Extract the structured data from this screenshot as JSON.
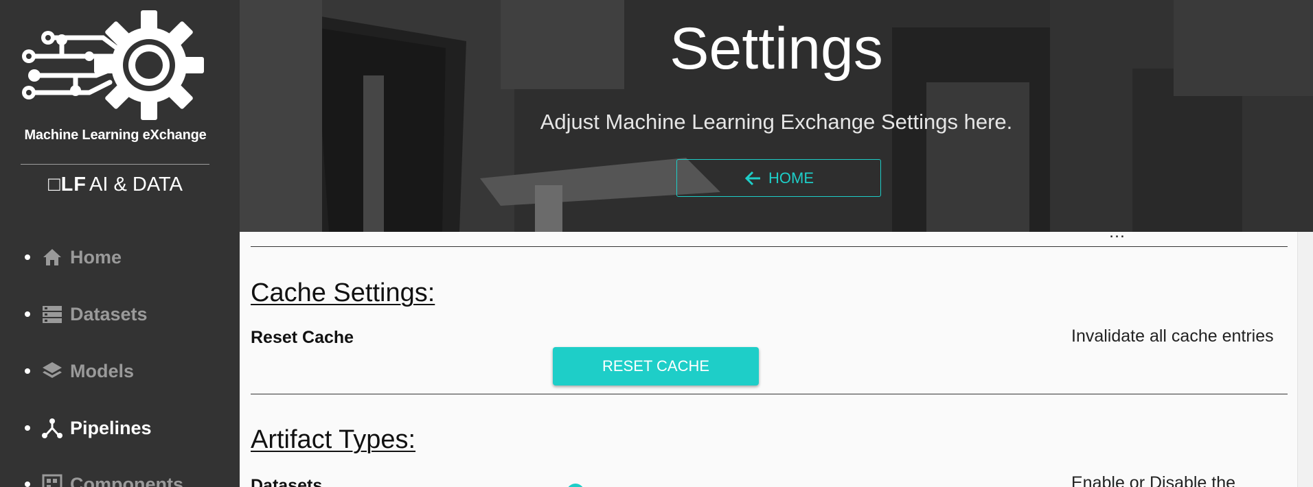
{
  "brand": {
    "name": "Machine Learning eXchange",
    "partner_mark": "□LF",
    "partner_text": "AI & DATA"
  },
  "nav": {
    "items": [
      {
        "label": "Home",
        "icon": "home-icon",
        "active": false
      },
      {
        "label": "Datasets",
        "icon": "datasets-icon",
        "active": false
      },
      {
        "label": "Models",
        "icon": "layers-icon",
        "active": false
      },
      {
        "label": "Pipelines",
        "icon": "pipeline-icon",
        "active": true
      },
      {
        "label": "Components",
        "icon": "components-icon",
        "active": false
      }
    ]
  },
  "hero": {
    "title": "Settings",
    "subtitle": "Adjust Machine Learning Exchange Settings here.",
    "home_button": "HOME"
  },
  "cache": {
    "title": "Cache Settings:",
    "label": "Reset Cache",
    "button": "RESET CACHE",
    "description": "Invalidate all cache entries"
  },
  "artifacts": {
    "title": "Artifact Types:",
    "first_label": "Datasets",
    "first_description": "Enable or Disable the"
  },
  "colors": {
    "accent": "#1ecec8",
    "sidebar_bg": "#333333",
    "content_bg": "#fafafa"
  }
}
